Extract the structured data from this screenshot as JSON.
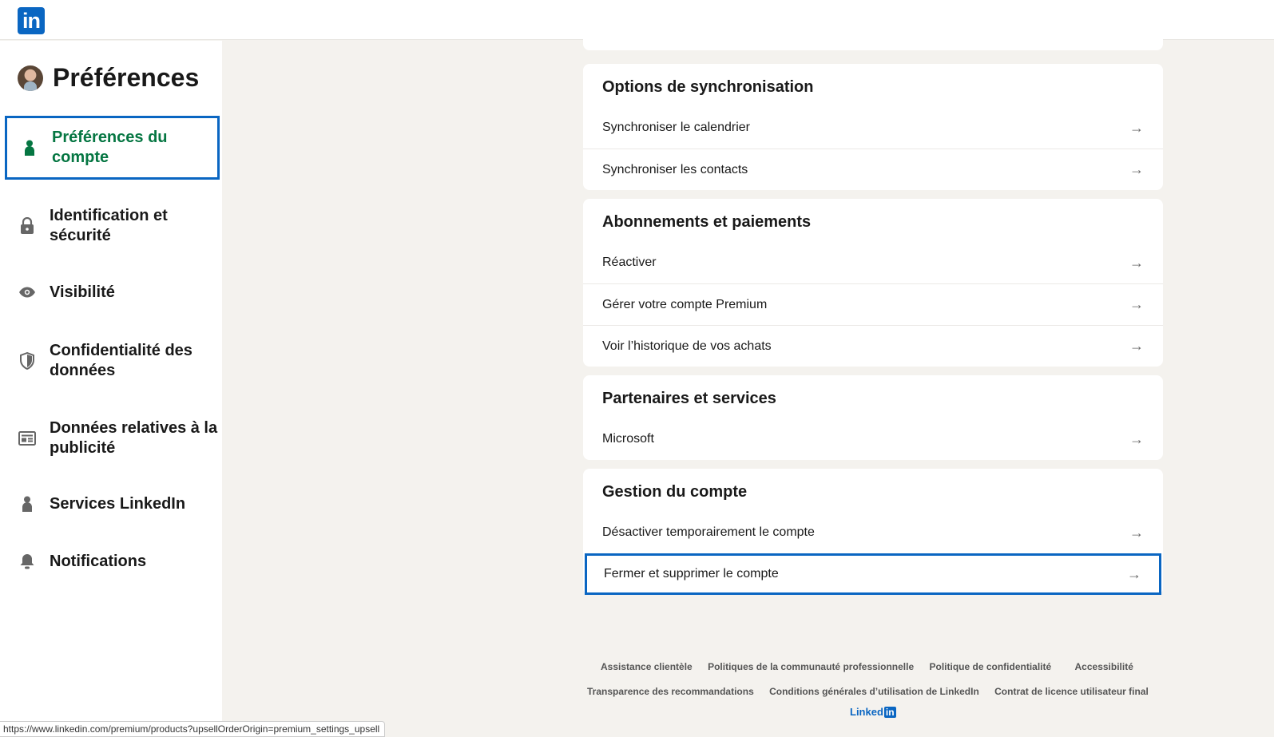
{
  "logo": {
    "text": "in"
  },
  "sidebar": {
    "title": "Préférences",
    "items": [
      {
        "label": "Préférences du compte",
        "icon": "person-icon",
        "active": true
      },
      {
        "label": "Identification et sécurité",
        "icon": "lock-icon"
      },
      {
        "label": "Visibilité",
        "icon": "eye-icon"
      },
      {
        "label": "Confidentialité des données",
        "icon": "shield-icon"
      },
      {
        "label": "Données relatives à la publicité",
        "icon": "newspaper-icon"
      },
      {
        "label": "Services LinkedIn",
        "icon": "person-icon"
      },
      {
        "label": "Notifications",
        "icon": "bell-icon"
      }
    ]
  },
  "sections": [
    {
      "title": "Options de synchronisation",
      "rows": [
        "Synchroniser le calendrier",
        "Synchroniser les contacts"
      ]
    },
    {
      "title": "Abonnements et paiements",
      "rows": [
        "Réactiver",
        "Gérer votre compte Premium",
        "Voir l’historique de vos achats"
      ]
    },
    {
      "title": "Partenaires et services",
      "rows": [
        "Microsoft"
      ]
    },
    {
      "title": "Gestion du compte",
      "rows": [
        "Désactiver temporairement le compte",
        "Fermer et supprimer le compte"
      ]
    }
  ],
  "arrow": "→",
  "footer": {
    "links_row1": [
      "Assistance clientèle",
      "Politiques de la communauté professionnelle",
      "Politique de confidentialité",
      "Accessibilité"
    ],
    "links_row2": [
      "Transparence des recommandations",
      "Conditions générales d’utilisation de LinkedIn",
      "Contrat de licence utilisateur final"
    ],
    "brand_text": "Linked",
    "brand_box": "in"
  },
  "status_url": "https://www.linkedin.com/premium/products?upsellOrderOrigin=premium_settings_upsell",
  "colors": {
    "accent": "#0a66c2",
    "active_green": "#057642",
    "background": "#f4f2ee"
  }
}
